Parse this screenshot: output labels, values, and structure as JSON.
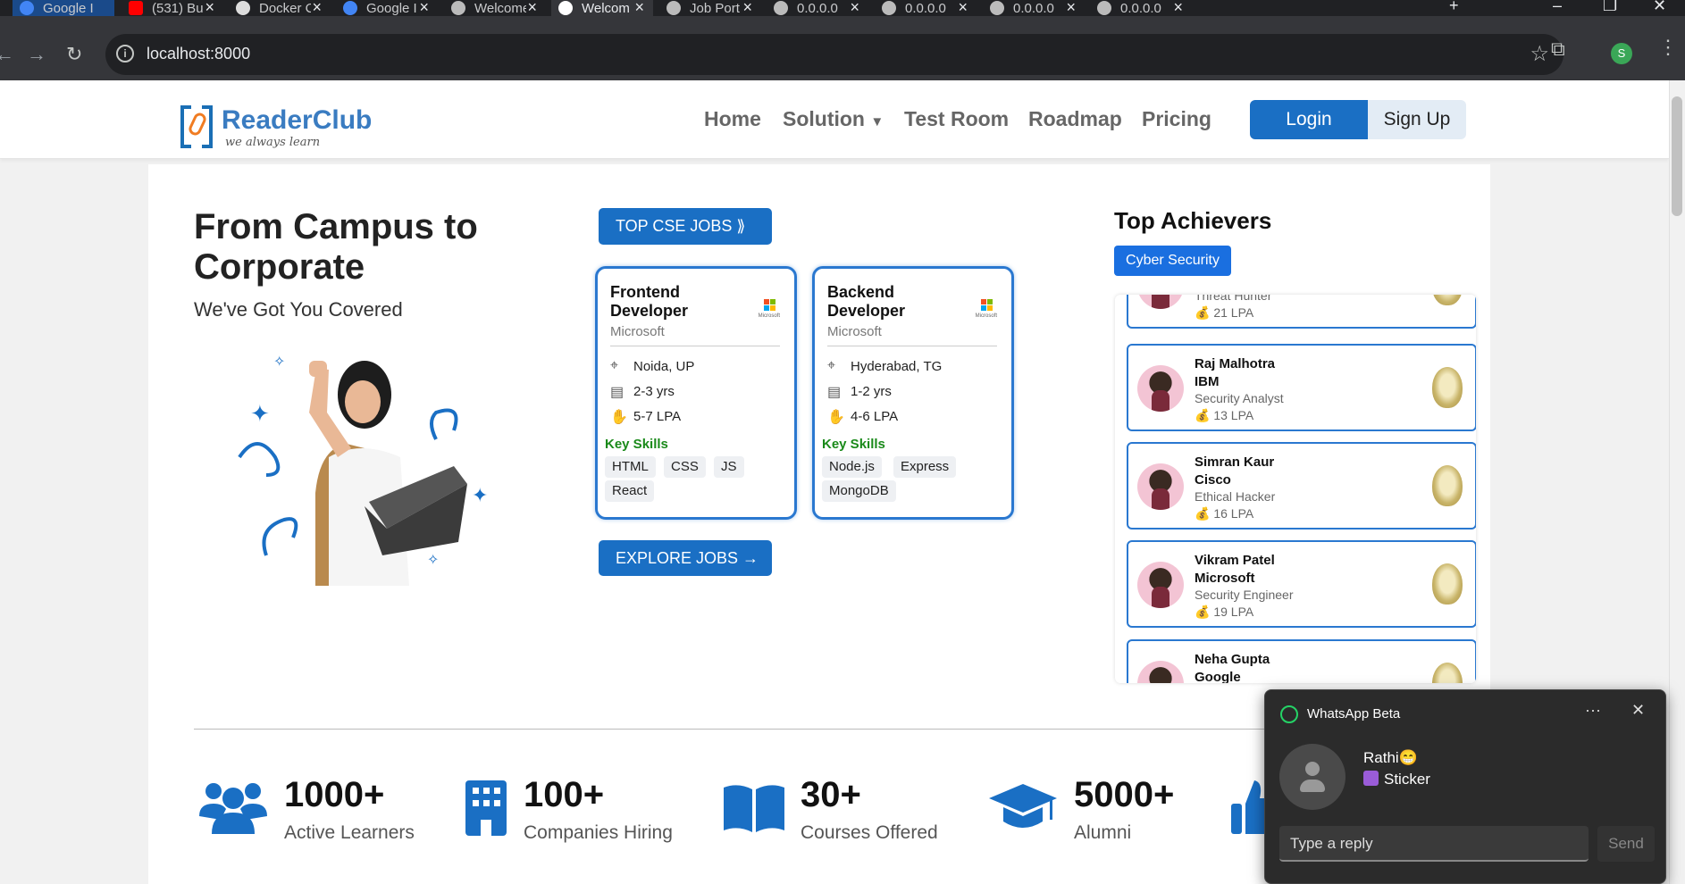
{
  "browser": {
    "tabs": [
      {
        "title": "Google I",
        "color": "#4285f4"
      },
      {
        "title": "(531) Bu",
        "color": "#ff0000"
      },
      {
        "title": "Docker C",
        "color": "#ffffff"
      },
      {
        "title": "Google I",
        "color": "#4285f4"
      },
      {
        "title": "Welcome",
        "color": "#bbbbbb"
      },
      {
        "title": "Welcom",
        "color": "#ffffff",
        "active": true
      },
      {
        "title": "Job Port",
        "color": "#bbbbbb"
      },
      {
        "title": "0.0.0.0",
        "color": "#bbbbbb"
      },
      {
        "title": "0.0.0.0",
        "color": "#bbbbbb"
      },
      {
        "title": "0.0.0.0",
        "color": "#bbbbbb"
      },
      {
        "title": "0.0.0.0",
        "color": "#bbbbbb"
      }
    ],
    "url": "localhost:8000",
    "profile_initial": "S"
  },
  "header": {
    "brand": "ReaderClub",
    "tagline": "we always learn",
    "nav": [
      "Home",
      "Solution",
      "Test Room",
      "Roadmap",
      "Pricing"
    ],
    "login": "Login",
    "signup": "Sign Up"
  },
  "hero": {
    "title": "From Campus to Corporate",
    "subtitle": "We've Got You Covered"
  },
  "jobs": {
    "top_label": "TOP CSE JOBS",
    "explore_label": "EXPLORE JOBS →",
    "skills_label": "Key Skills",
    "logo_text": "Microsoft",
    "cards": [
      {
        "title": "Frontend Developer",
        "company": "Microsoft",
        "location": "Noida, UP",
        "experience": "2-3 yrs",
        "salary": "5-7 LPA",
        "skills": [
          "HTML",
          "CSS",
          "JS",
          "React"
        ]
      },
      {
        "title": "Backend Developer",
        "company": "Microsoft",
        "location": "Hyderabad, TG",
        "experience": "1-2 yrs",
        "salary": "4-6 LPA",
        "skills": [
          "Node.js",
          "Express",
          "MongoDB"
        ]
      }
    ]
  },
  "achievers": {
    "title": "Top Achievers",
    "category": "Cyber Security",
    "list": [
      {
        "name": "",
        "company": "",
        "role": "Threat Hunter",
        "lpa": "21 LPA"
      },
      {
        "name": "Raj Malhotra",
        "company": "IBM",
        "role": "Security Analyst",
        "lpa": "13 LPA"
      },
      {
        "name": "Simran Kaur",
        "company": "Cisco",
        "role": "Ethical Hacker",
        "lpa": "16 LPA"
      },
      {
        "name": "Vikram Patel",
        "company": "Microsoft",
        "role": "Security Engineer",
        "lpa": "19 LPA"
      },
      {
        "name": "Neha Gupta",
        "company": "Google",
        "role": "",
        "lpa": ""
      }
    ]
  },
  "stats": [
    {
      "number": "1000+",
      "label": "Active Learners",
      "icon": "users-icon"
    },
    {
      "number": "100+",
      "label": "Companies Hiring",
      "icon": "building-icon"
    },
    {
      "number": "30+",
      "label": "Courses Offered",
      "icon": "book-icon"
    },
    {
      "number": "5000+",
      "label": "Alumni",
      "icon": "graduation-cap-icon"
    }
  ],
  "whatsapp": {
    "app": "WhatsApp Beta",
    "sender": "Rathi😁",
    "message": "Sticker",
    "reply_placeholder": "Type a reply",
    "send": "Send"
  }
}
